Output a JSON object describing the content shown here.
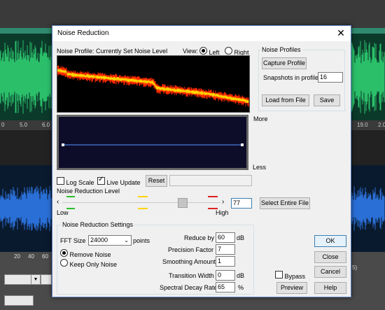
{
  "background": {
    "ruler_ticks": [
      "0",
      "5.0",
      "6.0",
      "19.0",
      "2.0"
    ],
    "bottom_ticks": [
      "20",
      "40",
      "60"
    ],
    "partial_label": "5)"
  },
  "dialog": {
    "title": "Noise Reduction",
    "noise_profile_label": "Noise Profile: Currently Set Noise Level",
    "view_label": "View:",
    "view_left": "Left",
    "view_right": "Right",
    "view_selected": "Left",
    "more_label": "More",
    "less_label": "Less",
    "log_scale_label": "Log Scale",
    "log_scale_checked": false,
    "live_update_label": "Live Update",
    "live_update_checked": true,
    "reset_label": "Reset",
    "reset_field_value": "",
    "nr_level_label": "Noise Reduction Level",
    "low_label": "Low",
    "high_label": "High",
    "nr_level_value": "77",
    "nr_level_fraction": 0.77,
    "select_entire_file_label": "Select Entire File",
    "noise_profiles": {
      "group_label": "Noise Profiles",
      "capture_label": "Capture Profile",
      "snapshots_label": "Snapshots in profile",
      "snapshots_value": "16",
      "load_label": "Load from File",
      "save_label": "Save"
    },
    "settings": {
      "group_label": "Noise Reduction Settings",
      "fft_label": "FFT Size",
      "fft_value": "24000",
      "points_label": "points",
      "remove_noise_label": "Remove Noise",
      "keep_only_noise_label": "Keep Only Noise",
      "mode_selected": "Remove Noise",
      "reduce_by_label": "Reduce by",
      "reduce_by_value": "60",
      "reduce_by_unit": "dB",
      "precision_label": "Precision Factor",
      "precision_value": "7",
      "smoothing_label": "Smoothing Amount",
      "smoothing_value": "1",
      "transition_label": "Transition Width",
      "transition_value": "0",
      "transition_unit": "dB",
      "decay_label": "Spectral Decay Rate",
      "decay_value": "65",
      "decay_unit": "%"
    },
    "bypass_label": "Bypass",
    "bypass_checked": false,
    "buttons": {
      "ok": "OK",
      "close": "Close",
      "cancel": "Cancel",
      "preview": "Preview",
      "help": "Help"
    }
  },
  "colors": {
    "accent": "#3c7fb1",
    "profile_red": "#ff2a00",
    "profile_yellow": "#ffd400",
    "curve_blue": "#4a7bd8",
    "wave_green": "#2bbf6a",
    "wave_blue": "#2a6fd6"
  }
}
